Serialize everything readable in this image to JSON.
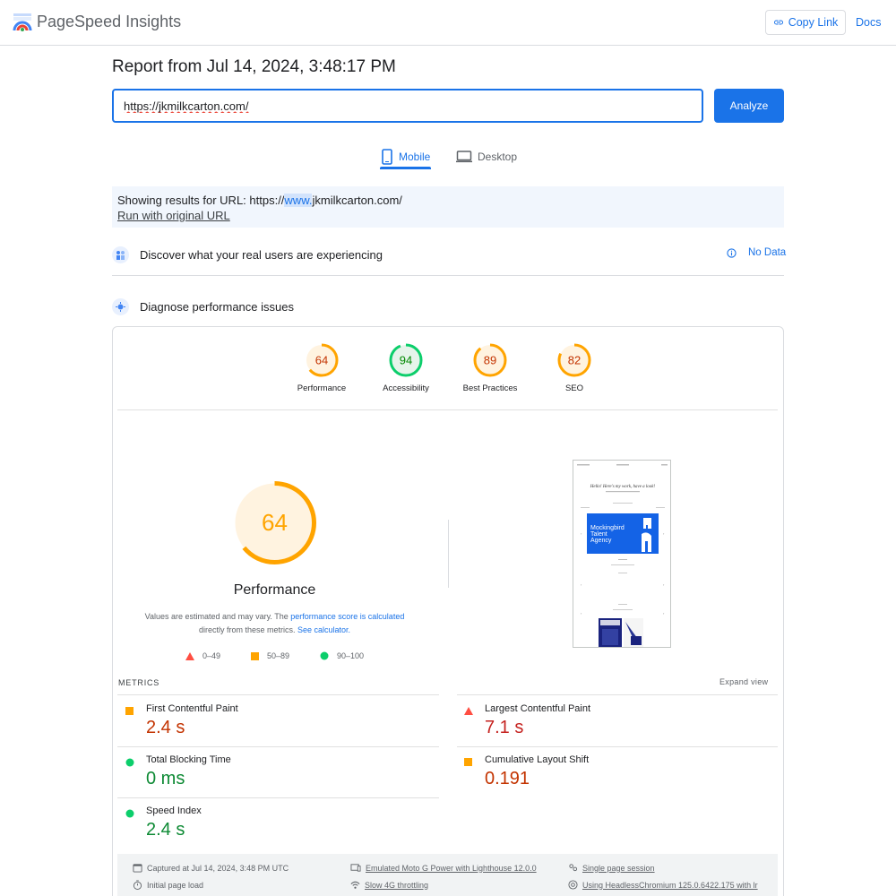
{
  "header": {
    "brand": "PageSpeed Insights",
    "copy_link": "Copy Link",
    "docs": "Docs"
  },
  "report": {
    "title": "Report from Jul 14, 2024, 3:48:17 PM",
    "url_value": "https://jkmilkcarton.com/",
    "analyze": "Analyze"
  },
  "tabs": {
    "mobile": "Mobile",
    "desktop": "Desktop"
  },
  "notice": {
    "prefix": "Showing results for URL: https://",
    "highlight": "www.",
    "suffix": "jkmilkcarton.com/",
    "run_original": "Run with original URL"
  },
  "sections": {
    "real_users": "Discover what your real users are experiencing",
    "no_data": "No Data",
    "diagnose": "Diagnose performance issues"
  },
  "scores": [
    {
      "label": "Performance",
      "value": 64,
      "color": "#ffa400",
      "bg": "#fff3e0",
      "text_color": "#c33300"
    },
    {
      "label": "Accessibility",
      "value": 94,
      "color": "#0cce6b",
      "bg": "#e6f4ea",
      "text_color": "#008800"
    },
    {
      "label": "Best Practices",
      "value": 89,
      "color": "#ffa400",
      "bg": "#fff3e0",
      "text_color": "#c33300"
    },
    {
      "label": "SEO",
      "value": 82,
      "color": "#ffa400",
      "bg": "#fff3e0",
      "text_color": "#c33300"
    }
  ],
  "main_gauge": {
    "value": 64,
    "title": "Performance",
    "note_pre": "Values are estimated and may vary. The ",
    "note_link1": "performance score is calculated",
    "note_mid": "directly from these metrics. ",
    "note_link2": "See calculator."
  },
  "legend": {
    "fail": "0–49",
    "average": "50–89",
    "pass": "90–100"
  },
  "screenshot": {
    "headline": "Hello! Here's my work, have a look!",
    "banner_line1": "Mockingbird",
    "banner_line2": "Talent",
    "banner_line3": "Agency"
  },
  "metrics": {
    "label": "METRICS",
    "expand": "Expand view",
    "items": [
      {
        "name": "First Contentful Paint",
        "value": "2.4 s",
        "rating": "average"
      },
      {
        "name": "Largest Contentful Paint",
        "value": "7.1 s",
        "rating": "fail"
      },
      {
        "name": "Total Blocking Time",
        "value": "0 ms",
        "rating": "pass"
      },
      {
        "name": "Cumulative Layout Shift",
        "value": "0.191",
        "rating": "average"
      },
      {
        "name": "Speed Index",
        "value": "2.4 s",
        "rating": "pass"
      }
    ]
  },
  "footer": {
    "captured": "Captured at Jul 14, 2024, 3:48 PM UTC",
    "initial": "Initial page load",
    "emulated": "Emulated Moto G Power with Lighthouse 12.0.0",
    "throttling": "Slow 4G throttling",
    "session": "Single page session",
    "browser": "Using HeadlessChromium 125.0.6422.175 with lr"
  },
  "colors": {
    "accent": "#1a73e8",
    "fail": "#ff4e42",
    "average": "#ffa400",
    "pass": "#0cce6b"
  }
}
